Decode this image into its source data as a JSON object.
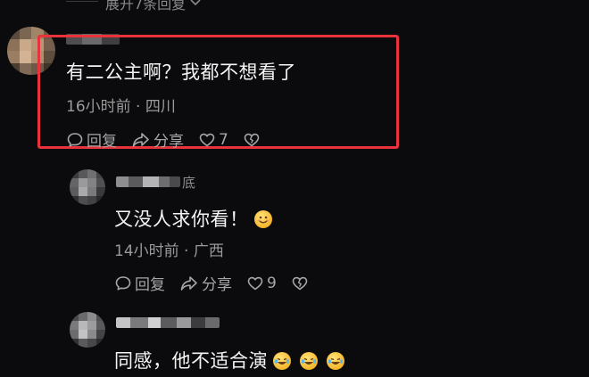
{
  "top": {
    "expand_label": "展开7条回复"
  },
  "comments": [
    {
      "text": "有二公主啊？我都不想看了",
      "meta": "16小时前 · 四川",
      "reply_label": "回复",
      "share_label": "分享",
      "like_count": "7",
      "highlighted": true
    },
    {
      "username_tail": "底",
      "text": "又没人求你看！",
      "emoji": "smile-emoji",
      "meta": "14小时前 · 广西",
      "reply_label": "回复",
      "share_label": "分享",
      "like_count": "9"
    },
    {
      "text": "同感，他不适合演",
      "emoji": [
        "laugh-cry-emoji",
        "laugh-cry-emoji",
        "laugh-cry-emoji"
      ]
    }
  ],
  "colors": {
    "background": "#0b0b0d",
    "highlight_border": "#e8323c",
    "primary_text": "#f4f4f4",
    "secondary_text": "#9a9a9a"
  }
}
